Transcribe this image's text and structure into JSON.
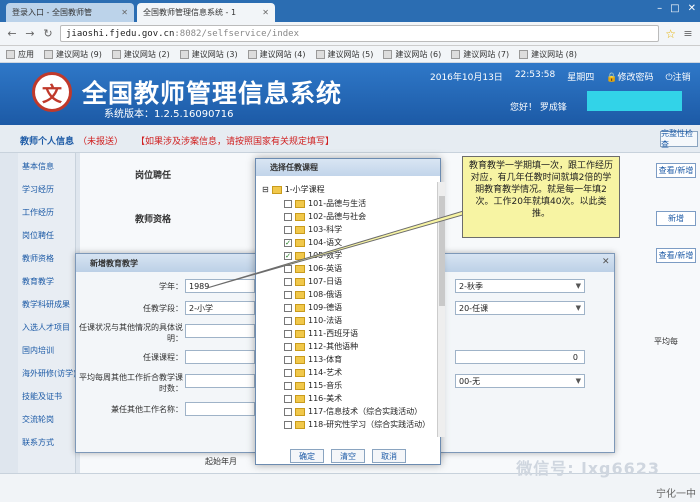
{
  "browser": {
    "tabs": [
      {
        "label": "登录入口 - 全国教师管"
      },
      {
        "label": "全国教师管理信息系统 - 1"
      }
    ],
    "url_host": "jiaoshi.fjedu.gov.cn",
    "url_path": ":8082/selfservice/index",
    "bookmarks": [
      "应用",
      "建议网站 (9)",
      "建议网站 (2)",
      "建议网站 (3)",
      "建议网站 (4)",
      "建议网站 (5)",
      "建议网站 (6)",
      "建议网站 (7)",
      "建议网站 (8)"
    ]
  },
  "header": {
    "title": "全国教师管理信息系统",
    "version": "系统版本：1.2.5.16090716",
    "date": "2016年10月13日",
    "time": "22:53:58",
    "weekday": "星期四",
    "change_password": "修改密码",
    "logout": "注销",
    "welcome": "您好！ 罗成锋"
  },
  "page": {
    "section_title": "教师个人信息",
    "section_status": "（未报送）",
    "warning": "【如果涉及涉案信息，请按照国家有关规定填写】",
    "corner_button": "完整性检查",
    "sidebar": [
      "基本信息",
      "学习经历",
      "工作经历",
      "岗位聘任",
      "教师资格",
      "教育教学",
      "教学科研成果",
      "入选人才项目",
      "国内培训",
      "海外研修(访学)",
      "技能及证书",
      "交流轮岗",
      "联系方式"
    ],
    "sections": [
      "岗位聘任",
      "教师资格"
    ],
    "side_buttons": [
      "查看/新增",
      "新增",
      "查看/新增"
    ],
    "bottom_columns": [
      "起始年月",
      "平均每"
    ]
  },
  "dialog_teaching": {
    "title": "新增教育教学",
    "fields": [
      {
        "label": "学年：",
        "value": "1989"
      },
      {
        "label": "任教学段：",
        "value": "2-小学"
      },
      {
        "label": "任课状况与其他情况的具体说明：",
        "value": ""
      },
      {
        "label": "任课课程：",
        "value": ""
      },
      {
        "label": "平均每周其他工作折合教学课时数：",
        "value": ""
      },
      {
        "label": "兼任其他工作名称：",
        "value": ""
      }
    ],
    "right_values": [
      "2-秋季",
      "20-任课",
      "0",
      "00-无"
    ]
  },
  "dialog_course": {
    "title": "选择任教课程",
    "root": "1-小学课程",
    "courses": [
      {
        "label": "101-品德与生活",
        "checked": false
      },
      {
        "label": "102-品德与社会",
        "checked": false
      },
      {
        "label": "103-科学",
        "checked": false
      },
      {
        "label": "104-语文",
        "checked": true
      },
      {
        "label": "105-数学",
        "checked": true
      },
      {
        "label": "106-英语",
        "checked": false
      },
      {
        "label": "107-日语",
        "checked": false
      },
      {
        "label": "108-俄语",
        "checked": false
      },
      {
        "label": "109-德语",
        "checked": false
      },
      {
        "label": "110-法语",
        "checked": false
      },
      {
        "label": "111-西班牙语",
        "checked": false
      },
      {
        "label": "112-其他语种",
        "checked": false
      },
      {
        "label": "113-体育",
        "checked": false
      },
      {
        "label": "114-艺术",
        "checked": false
      },
      {
        "label": "115-音乐",
        "checked": false
      },
      {
        "label": "116-美术",
        "checked": false
      },
      {
        "label": "117-信息技术（综合实践活动）",
        "checked": false
      },
      {
        "label": "118-研究性学习（综合实践活动）",
        "checked": false
      }
    ],
    "buttons": {
      "ok": "确定",
      "clear": "清空",
      "cancel": "取消"
    }
  },
  "callout": {
    "text": "教育教学一学期填一次，跟工作经历对应，有几年任教时间就填2倍的学期教育教学情况。就是每一年填2次。工作20年就填40次。以此类推。"
  },
  "watermark": {
    "text": "微信号: lxg6623",
    "bottom_text": "宁化一中"
  },
  "colors": {
    "header_blue": "#1c5aa6",
    "warning_red": "#d02020",
    "callout_yellow": "#f7f4a3",
    "name_box": "#32d3e8"
  }
}
